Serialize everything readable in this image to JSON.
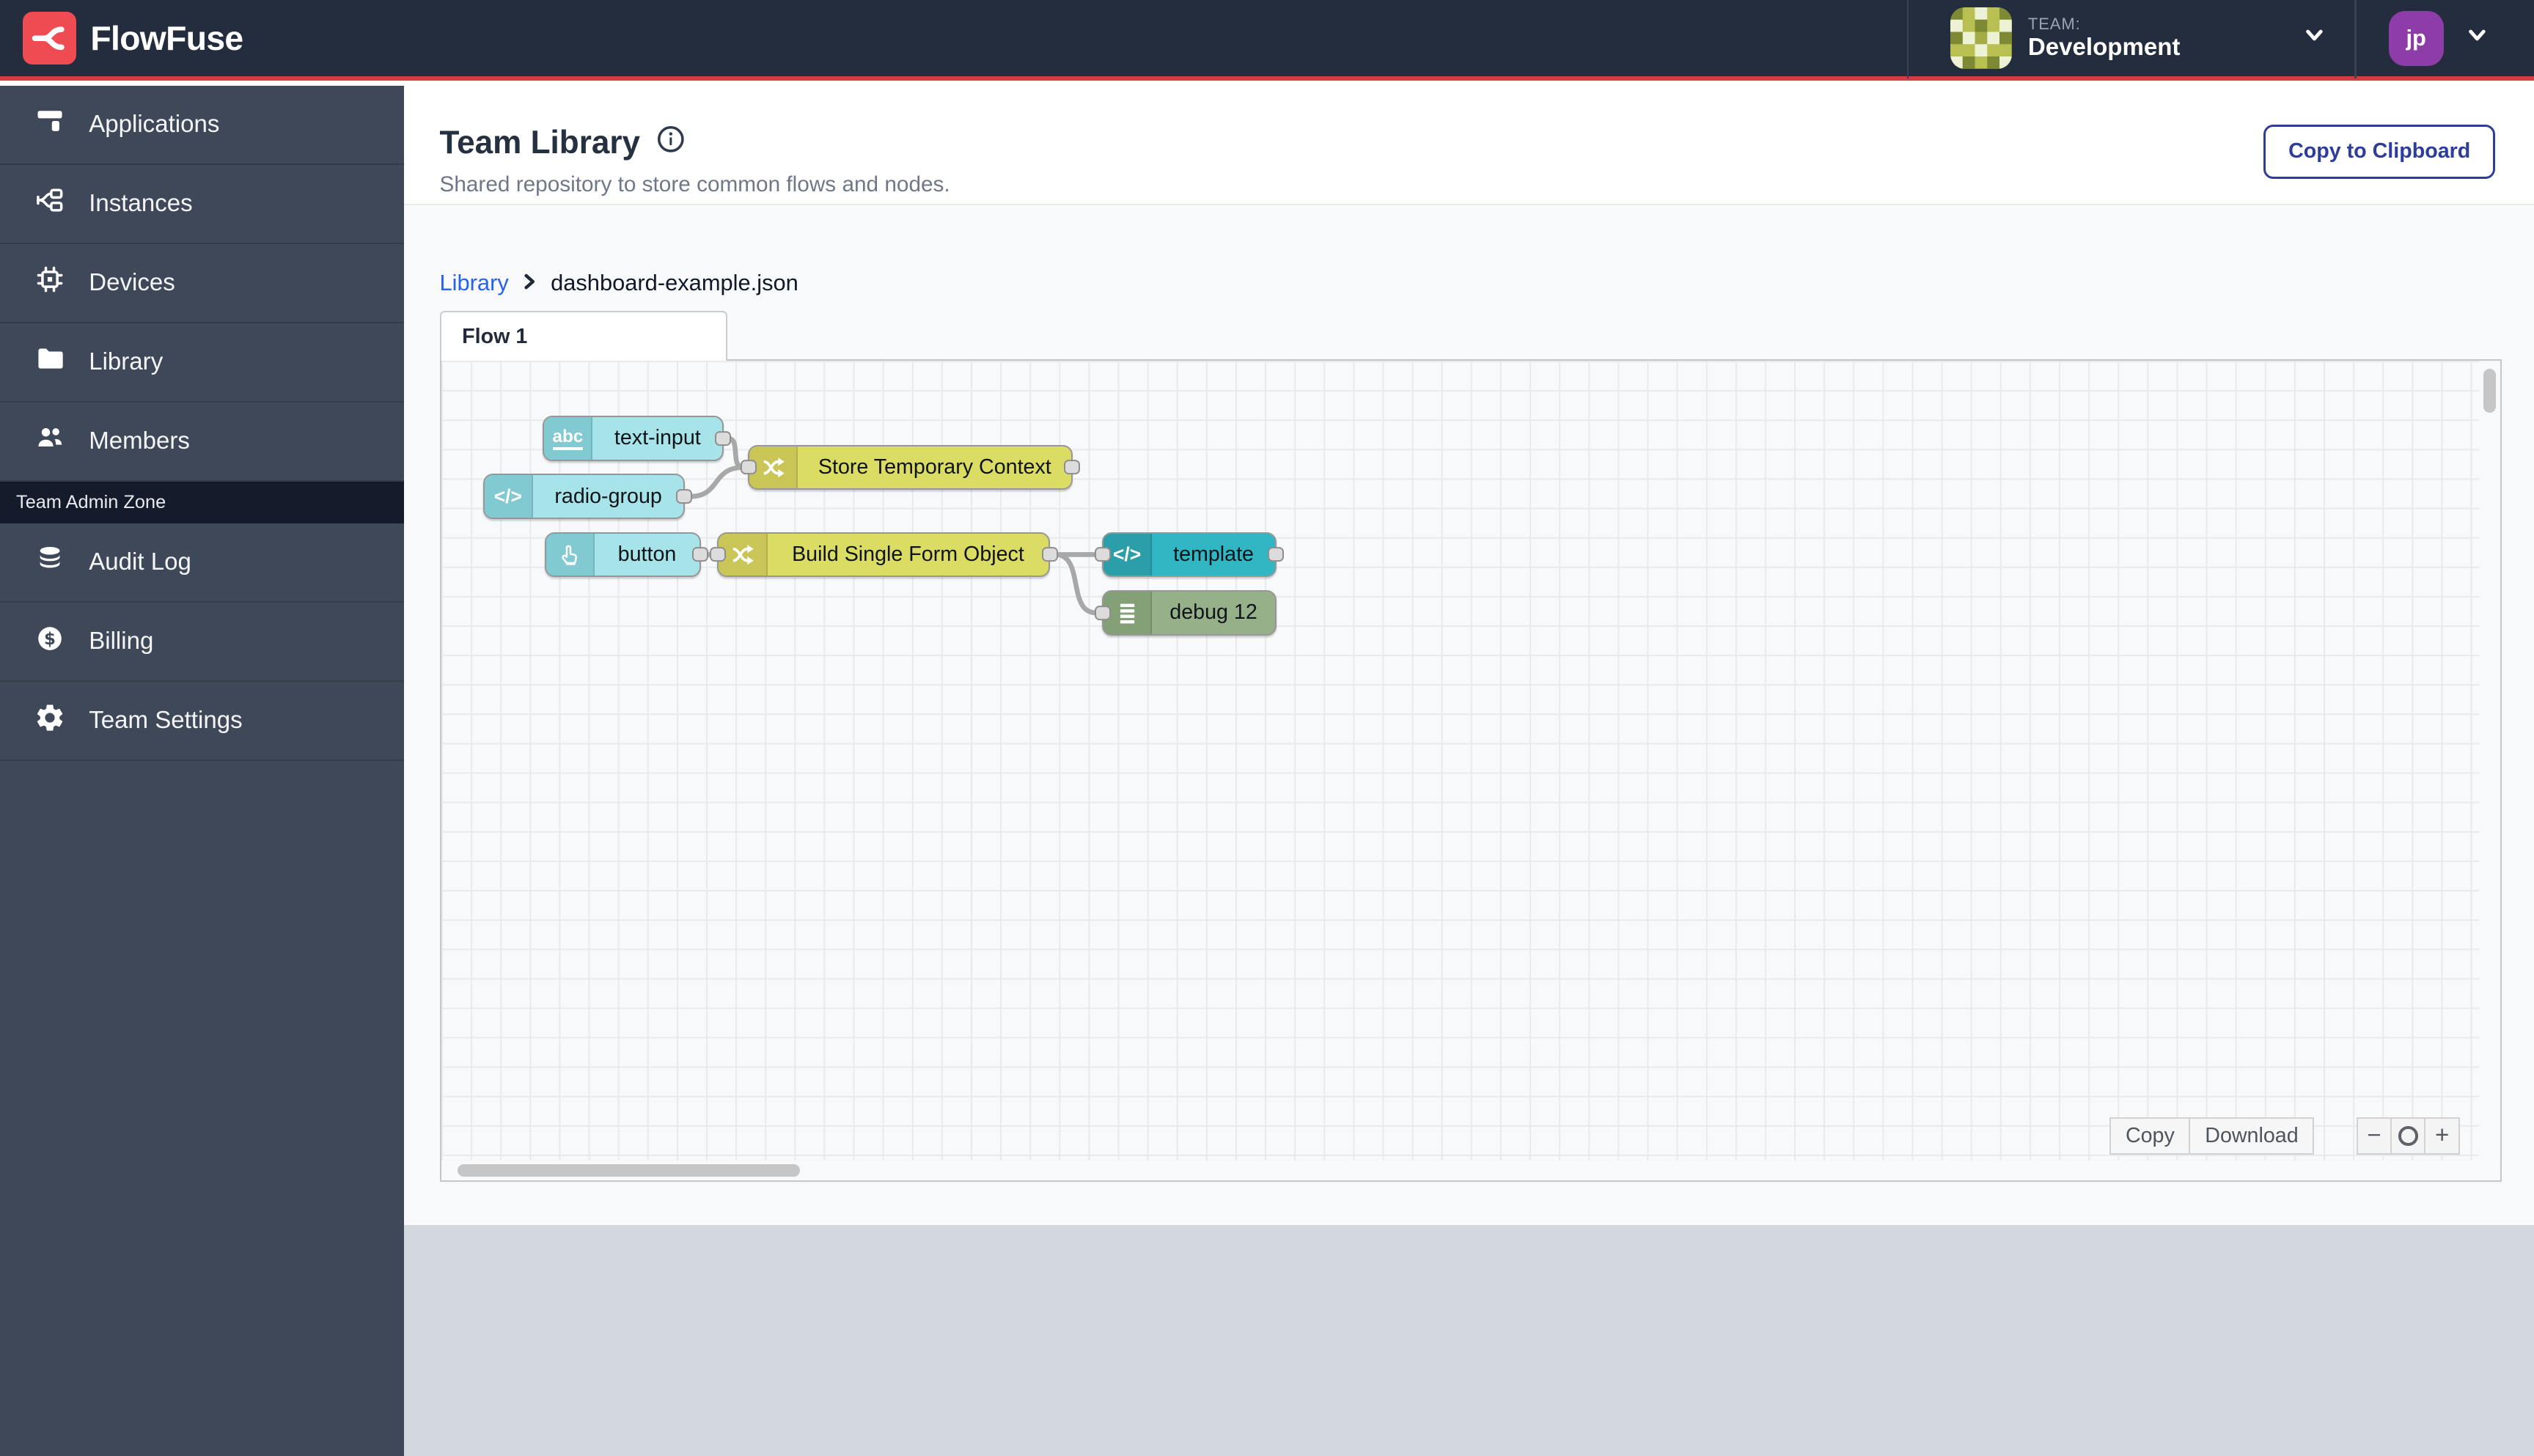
{
  "header": {
    "brand": "FlowFuse",
    "team_label": "TEAM:",
    "team_name": "Development",
    "user_initials": "jp"
  },
  "sidebar": {
    "items": [
      {
        "label": "Applications"
      },
      {
        "label": "Instances"
      },
      {
        "label": "Devices"
      },
      {
        "label": "Library"
      },
      {
        "label": "Members"
      }
    ],
    "admin_zone_label": "Team Admin Zone",
    "admin_items": [
      {
        "label": "Audit Log"
      },
      {
        "label": "Billing"
      },
      {
        "label": "Team Settings"
      }
    ]
  },
  "page": {
    "title": "Team Library",
    "subtitle": "Shared repository to store common flows and nodes.",
    "copy_to_clipboard": "Copy to Clipboard"
  },
  "breadcrumb": {
    "root": "Library",
    "current": "dashboard-example.json"
  },
  "flow": {
    "tab_label": "Flow 1",
    "nodes": [
      {
        "label": "text-input",
        "type": "ui-text-input",
        "icon_text": "abc"
      },
      {
        "label": "radio-group",
        "type": "ui-radio-group",
        "icon_text": "</>"
      },
      {
        "label": "Store Temporary Context",
        "type": "change"
      },
      {
        "label": "button",
        "type": "ui-button"
      },
      {
        "label": "Build Single Form Object",
        "type": "change"
      },
      {
        "label": "template",
        "type": "template",
        "icon_text": "</>"
      },
      {
        "label": "debug 12",
        "type": "debug"
      }
    ],
    "controls": {
      "copy": "Copy",
      "download": "Download",
      "zoom_out": "−",
      "zoom_in": "+"
    }
  },
  "colors": {
    "header_bg": "#232D3D",
    "accent_red": "#D83A44",
    "logo_red": "#EE4B53",
    "sidebar_bg": "#3F4859",
    "admin_zone_bg": "#141B2B",
    "link_blue": "#2563EB",
    "button_blue": "#2E3D99",
    "user_avatar_purple": "#8E3CA8",
    "node_cyan": "#A7E4E9",
    "node_cyan_icon": "#82CAD1",
    "node_yellow": "#DBDC64",
    "node_yellow_icon": "#C9C556",
    "node_teal": "#31B7C3",
    "node_teal_icon": "#2A9FAA",
    "node_green": "#96B18A",
    "node_green_icon": "#83A077",
    "canvas_bg": "#F8F9FA",
    "footer_gray": "#D3D7DE"
  }
}
